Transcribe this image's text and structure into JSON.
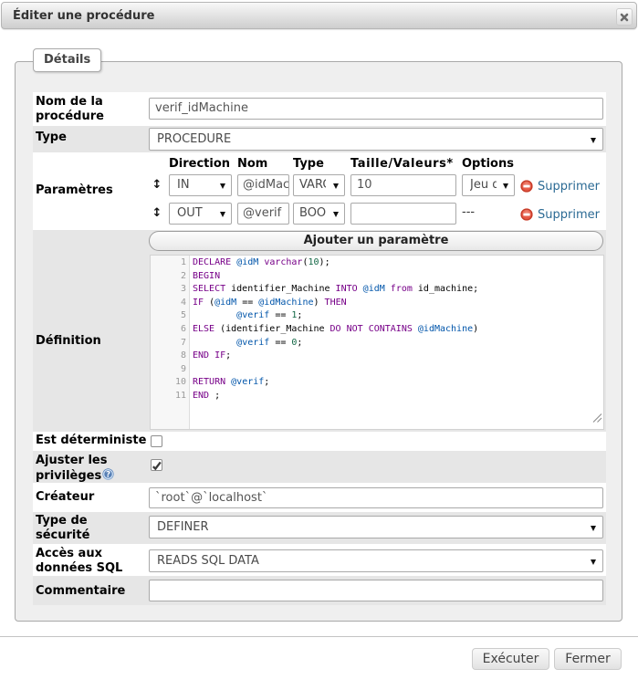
{
  "dialog": {
    "title": "Éditer une procédure",
    "close_icon": "✖"
  },
  "tab": {
    "label": "Détails"
  },
  "form": {
    "name": {
      "label": "Nom de la procédure",
      "value": "verif_idMachine"
    },
    "type": {
      "label": "Type",
      "value": "PROCEDURE"
    },
    "parameters": {
      "label": "Paramètres",
      "headers": {
        "direction": "Direction",
        "name": "Nom",
        "type": "Type",
        "length": "Taille/Valeurs*",
        "options": "Options"
      },
      "drag_icon": "↕",
      "rows": [
        {
          "direction": "IN",
          "name": "@idMachine",
          "type": "VARCHAR",
          "length": "10",
          "options": "Jeu de caractères",
          "remove_label": "Supprimer"
        },
        {
          "direction": "OUT",
          "name": "@verif",
          "type": "BOOLEAN",
          "length": "",
          "options": "---",
          "remove_label": "Supprimer"
        }
      ],
      "add_button": "Ajouter un paramètre"
    },
    "definition": {
      "label": "Définition"
    },
    "deterministic": {
      "label": "Est déterministe",
      "checked": false
    },
    "adjust_privileges": {
      "label": "Ajuster les privilèges",
      "checked": true,
      "checkmark": "✓"
    },
    "creator": {
      "label": "Créateur",
      "value": "`root`@`localhost`"
    },
    "security_type": {
      "label": "Type de sécurité",
      "value": "DEFINER"
    },
    "sql_data_access": {
      "label": "Accès aux données SQL",
      "value": "READS SQL DATA"
    },
    "comment": {
      "label": "Commentaire",
      "value": ""
    }
  },
  "code": {
    "lines": [
      [
        [
          "DECLARE",
          "k"
        ],
        [
          " ",
          ""
        ],
        [
          "@idM",
          "v"
        ],
        [
          " ",
          ""
        ],
        [
          "varchar",
          "k"
        ],
        [
          "(",
          ""
        ],
        [
          "10",
          "n"
        ],
        [
          ");",
          ""
        ]
      ],
      [
        [
          "BEGIN",
          "k"
        ]
      ],
      [
        [
          "SELECT",
          "k"
        ],
        [
          " identifier_Machine ",
          ""
        ],
        [
          "INTO",
          "k"
        ],
        [
          " ",
          ""
        ],
        [
          "@idM",
          "v"
        ],
        [
          " ",
          ""
        ],
        [
          "from",
          "k"
        ],
        [
          " id_machine;",
          ""
        ]
      ],
      [
        [
          "IF",
          "k"
        ],
        [
          " (",
          ""
        ],
        [
          "@idM",
          "v"
        ],
        [
          " == ",
          ""
        ],
        [
          "@idMachine",
          "v"
        ],
        [
          ") ",
          ""
        ],
        [
          "THEN",
          "k"
        ]
      ],
      [
        [
          "        ",
          ""
        ],
        [
          "@verif",
          "v"
        ],
        [
          " == ",
          ""
        ],
        [
          "1",
          "n"
        ],
        [
          ";",
          ""
        ]
      ],
      [
        [
          "ELSE",
          "k"
        ],
        [
          " (identifier_Machine ",
          ""
        ],
        [
          "DO",
          "k"
        ],
        [
          " ",
          ""
        ],
        [
          "NOT",
          "k"
        ],
        [
          " ",
          ""
        ],
        [
          "CONTAINS",
          "k"
        ],
        [
          " ",
          ""
        ],
        [
          "@idMachine",
          "v"
        ],
        [
          ")",
          ""
        ]
      ],
      [
        [
          "        ",
          ""
        ],
        [
          "@verif",
          "v"
        ],
        [
          " == ",
          ""
        ],
        [
          "0",
          "n"
        ],
        [
          ";",
          ""
        ]
      ],
      [
        [
          "END",
          "k"
        ],
        [
          " ",
          ""
        ],
        [
          "IF",
          "k"
        ],
        [
          ";",
          ""
        ]
      ],
      [],
      [
        [
          "RETURN",
          "k"
        ],
        [
          " ",
          ""
        ],
        [
          "@verif",
          "v"
        ],
        [
          ";",
          ""
        ]
      ],
      [
        [
          "END",
          "k"
        ],
        [
          " ;",
          ""
        ]
      ]
    ]
  },
  "buttons": {
    "execute": "Exécuter",
    "close": "Fermer"
  },
  "colors": {
    "accent_link": "#2b6a94",
    "row_stripe": "#e3e3e3",
    "keyword": "#770088",
    "variable": "#0055aa",
    "number": "#116644"
  }
}
